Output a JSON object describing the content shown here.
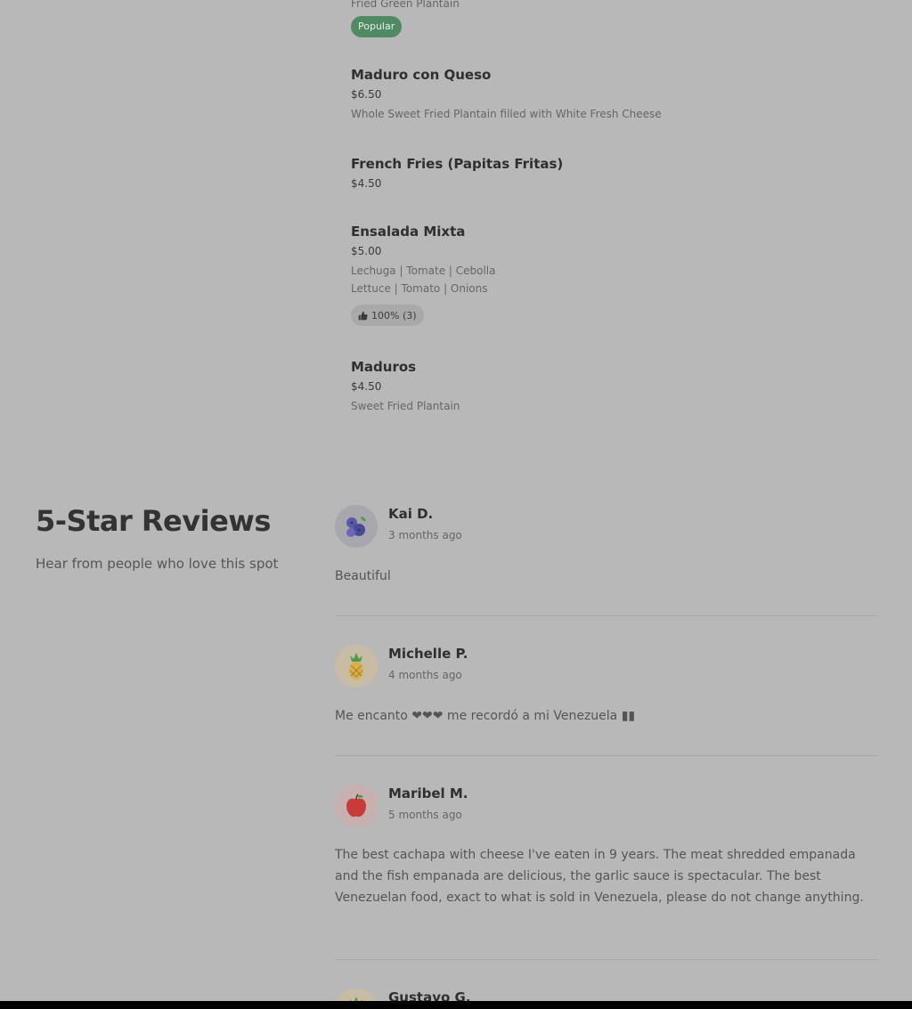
{
  "menu": {
    "items": [
      {
        "title": "",
        "price": "",
        "desc": "Fried Green Plantain",
        "badge": "Popular"
      },
      {
        "title": "Maduro con Queso",
        "price": "$6.50",
        "desc": "Whole Sweet Fried Plantain filled with White Fresh Cheese"
      },
      {
        "title": "French Fries (Papitas Fritas)",
        "price": "$4.50"
      },
      {
        "title": "Ensalada Mixta",
        "price": "$5.00",
        "desc_line1": "Lechuga | Tomate | Cebolla",
        "desc_line2": "Lettuce | Tomato | Onions",
        "rating": "100% (3)"
      },
      {
        "title": "Maduros",
        "price": "$4.50",
        "desc": "Sweet Fried Plantain"
      }
    ]
  },
  "reviews": {
    "heading": "5-Star Reviews",
    "subheading": "Hear from people who love this spot",
    "list": [
      {
        "name": "Kai D.",
        "time": "3 months ago",
        "text": "Beautiful",
        "avatar_icon": "blueberries-icon",
        "avatar_bg": "#a7a7ad"
      },
      {
        "name": "Michelle P.",
        "time": "4 months ago",
        "text": "Me encanto ❤❤❤ me recordó a mi Venezuela ▮▮",
        "avatar_icon": "pineapple-icon",
        "avatar_bg": "#c8bda4"
      },
      {
        "name": "Maribel M.",
        "time": "5 months ago",
        "text": "The best cachapa with cheese I've eaten in 9 years. The meat shredded empanada and the fish empanada are delicious, the garlic sauce is spectacular. The best Venezuelan food, exact to what is sold in Venezuela, please do not change anything.",
        "avatar_icon": "apple-icon",
        "avatar_bg": "#c9b0b0"
      },
      {
        "name": "Gustavo G.",
        "time": "",
        "text": "",
        "avatar_icon": "pineapple-icon",
        "avatar_bg": "#c8bda4"
      }
    ]
  },
  "colors": {
    "background": "#b8b8b8",
    "popular_badge": "#4f8a63"
  }
}
